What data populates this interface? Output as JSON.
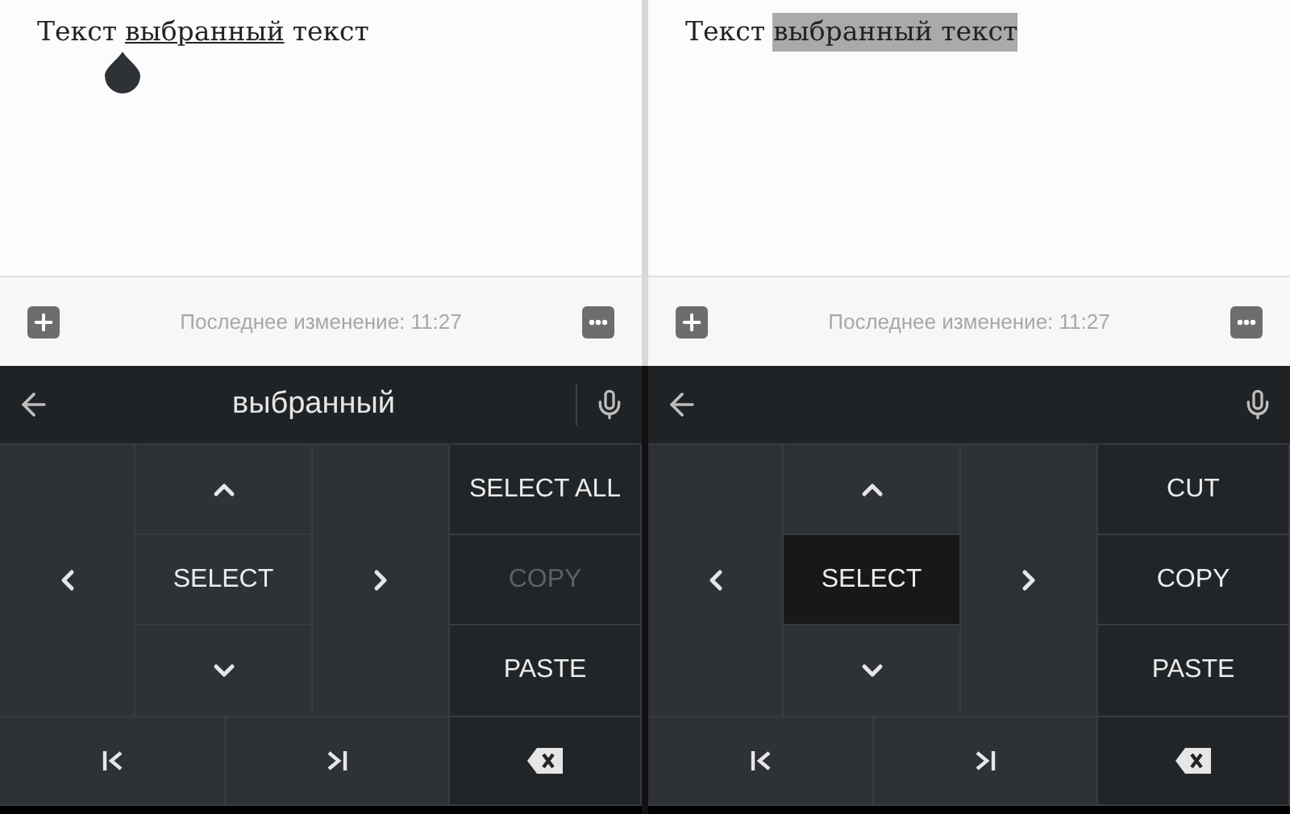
{
  "panels": [
    {
      "editor": {
        "segments": [
          {
            "text": "Текст",
            "kind": "plain"
          },
          {
            "text": "выбранный",
            "kind": "composing"
          },
          {
            "text": "текст",
            "kind": "plain"
          }
        ],
        "handle": true
      },
      "footer": {
        "status": "Последнее изменение: 11:27"
      },
      "keyboard": {
        "suggestion": "выбранный",
        "select_label": "SELECT",
        "select_selected": false,
        "actions": [
          {
            "label": "SELECT ALL",
            "disabled": false
          },
          {
            "label": "COPY",
            "disabled": true
          },
          {
            "label": "PASTE",
            "disabled": false
          }
        ]
      }
    },
    {
      "editor": {
        "segments": [
          {
            "text": "Текст",
            "kind": "plain"
          },
          {
            "text": "выбранный текст",
            "kind": "selected"
          }
        ],
        "handle": false
      },
      "footer": {
        "status": "Последнее изменение: 11:27"
      },
      "keyboard": {
        "select_label": "SELECT",
        "select_selected": true,
        "actions": [
          {
            "label": "CUT",
            "disabled": false
          },
          {
            "label": "COPY",
            "disabled": false
          },
          {
            "label": "PASTE",
            "disabled": false
          }
        ]
      }
    }
  ]
}
